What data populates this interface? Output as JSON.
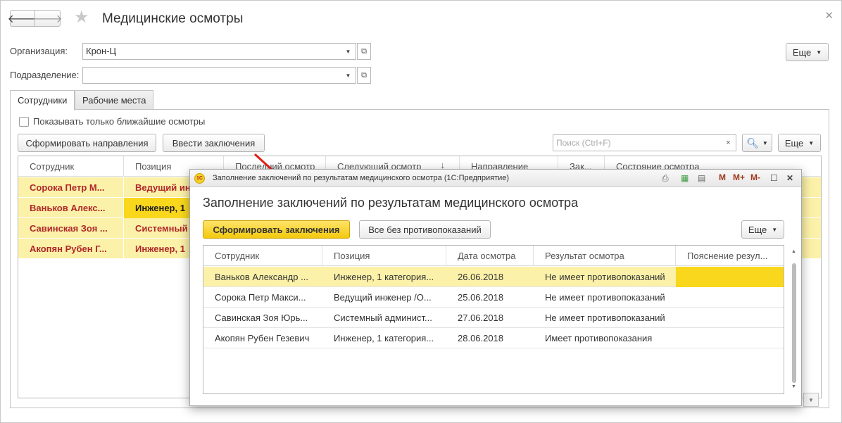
{
  "window": {
    "title": "Медицинские осмотры",
    "more_label": "Еще"
  },
  "filters": {
    "organization_label": "Организация:",
    "organization_value": "Крон-Ц",
    "department_label": "Подразделение:",
    "department_value": ""
  },
  "tabs": [
    {
      "label": "Сотрудники",
      "active": true
    },
    {
      "label": "Рабочие места",
      "active": false
    }
  ],
  "employees_tab": {
    "show_nearest_label": "Показывать только ближайшие осмотры",
    "show_nearest_checked": false,
    "btn_generate_referrals": "Сформировать направления",
    "btn_enter_conclusions": "Ввести заключения",
    "search_placeholder": "Поиск (Ctrl+F)",
    "search_clear": "×",
    "search_icon": "search-icon",
    "more_label": "Еще",
    "columns": [
      "Сотрудник",
      "Позиция",
      "Последний осмотр",
      "Следующий осмотр",
      "Направление",
      "Зак...",
      "Состояние осмотра"
    ],
    "sort_indicator": "↓",
    "rows": [
      {
        "employee": "Сорока Петр М...",
        "position": "Ведущий ин"
      },
      {
        "employee": "Ваньков Алекс...",
        "position": "Инженер, 1"
      },
      {
        "employee": "Савинская Зоя ...",
        "position": "Системный"
      },
      {
        "employee": "Акопян Рубен Г...",
        "position": "Инженер, 1"
      }
    ]
  },
  "modal": {
    "titlebar": "Заполнение заключений по результатам медицинского осмотра  (1С:Предприятие)",
    "logo": "1С",
    "toolbar_m": [
      "M",
      "M+",
      "M-"
    ],
    "heading": "Заполнение заключений по результатам медицинского осмотра",
    "btn_generate": "Сформировать заключения",
    "btn_all_clear": "Все без противопоказаний",
    "more_label": "Еще",
    "columns": [
      "Сотрудник",
      "Позиция",
      "Дата осмотра",
      "Результат осмотра",
      "Пояснение резул..."
    ],
    "rows": [
      {
        "employee": "Ваньков Александр ...",
        "position": "Инженер, 1 категория...",
        "date": "26.06.2018",
        "result": "Не имеет противопоказаний",
        "note": "",
        "selected": true
      },
      {
        "employee": "Сорока Петр Макси...",
        "position": "Ведущий инженер /О...",
        "date": "25.06.2018",
        "result": "Не имеет противопоказаний",
        "note": "",
        "selected": false
      },
      {
        "employee": "Савинская Зоя Юрь...",
        "position": "Системный админист...",
        "date": "27.06.2018",
        "result": "Не имеет противопоказаний",
        "note": "",
        "selected": false
      },
      {
        "employee": "Акопян Рубен Гезевич",
        "position": "Инженер, 1 категория...",
        "date": "28.06.2018",
        "result": "Имеет противопоказания",
        "note": "",
        "selected": false
      }
    ]
  },
  "colors": {
    "accent_yellow": "#f9d71d",
    "row_highlight": "#fbf1a8",
    "employee_text": "#b0272a",
    "arrow_red": "#e3201b"
  }
}
